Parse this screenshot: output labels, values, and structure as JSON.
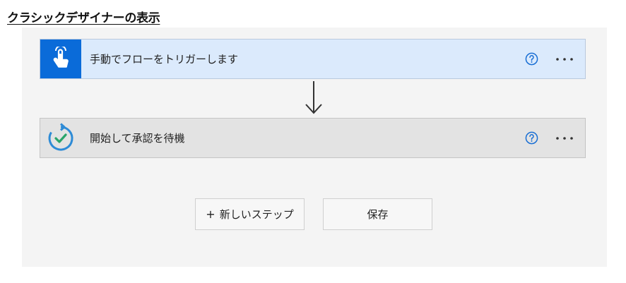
{
  "page": {
    "title": "クラシックデザイナーの表示"
  },
  "flow": {
    "steps": [
      {
        "title": "手動でフローをトリガーします",
        "icon": "hand-tap-icon",
        "accent": "#0a6bd9"
      },
      {
        "title": "開始して承認を待機",
        "icon": "approval-check-icon",
        "accent": "#2e8bd6"
      }
    ],
    "connector_icon": "arrow-down-icon"
  },
  "actions": {
    "new_step_plus": "+",
    "new_step_label": "新しいステップ",
    "save_label": "保存"
  },
  "colors": {
    "trigger_card_bg": "#dbeafc",
    "approval_card_bg": "#e3e3e3",
    "canvas_bg": "#f4f4f4",
    "help_icon": "#1a6fd4"
  }
}
